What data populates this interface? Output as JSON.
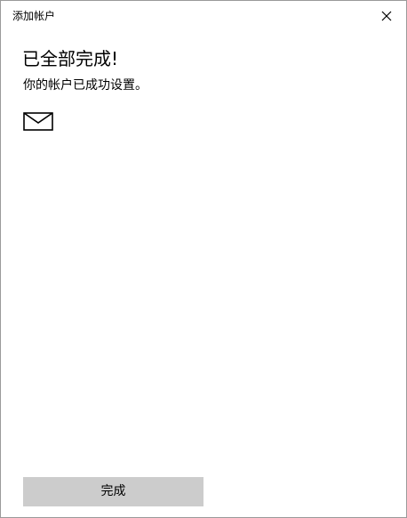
{
  "window": {
    "title": "添加帐户",
    "close_icon": "close-icon"
  },
  "content": {
    "heading": "已全部完成!",
    "message": "你的帐户已成功设置。",
    "mail_icon": "mail-icon"
  },
  "footer": {
    "done_label": "完成",
    "done_color": "#cccccc"
  }
}
